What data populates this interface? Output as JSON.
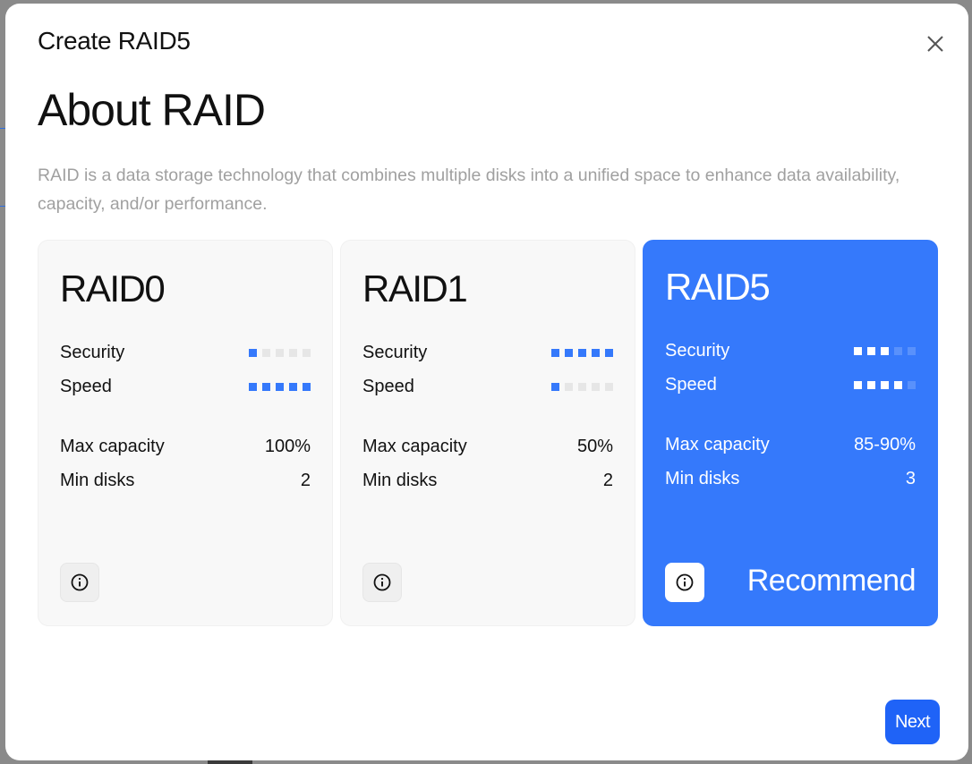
{
  "dialog": {
    "title": "Create RAID5",
    "heading": "About RAID",
    "description": "RAID is a data storage technology that combines multiple disks into a unified space to enhance data availability, capacity, and/or performance."
  },
  "labels": {
    "security": "Security",
    "speed": "Speed",
    "max_capacity": "Max capacity",
    "min_disks": "Min disks"
  },
  "cards": [
    {
      "name": "RAID0",
      "security_level": 1,
      "speed_level": 5,
      "max_capacity": "100%",
      "min_disks": "2",
      "selected": false
    },
    {
      "name": "RAID1",
      "security_level": 5,
      "speed_level": 1,
      "max_capacity": "50%",
      "min_disks": "2",
      "selected": false
    },
    {
      "name": "RAID5",
      "security_level": 3,
      "speed_level": 4,
      "max_capacity": "85-90%",
      "min_disks": "3",
      "selected": true,
      "badge": "Recommend"
    }
  ],
  "meter_max": 5,
  "footer": {
    "next_label": "Next"
  },
  "colors": {
    "accent": "#3579fb",
    "next_button": "#1f63f7"
  }
}
